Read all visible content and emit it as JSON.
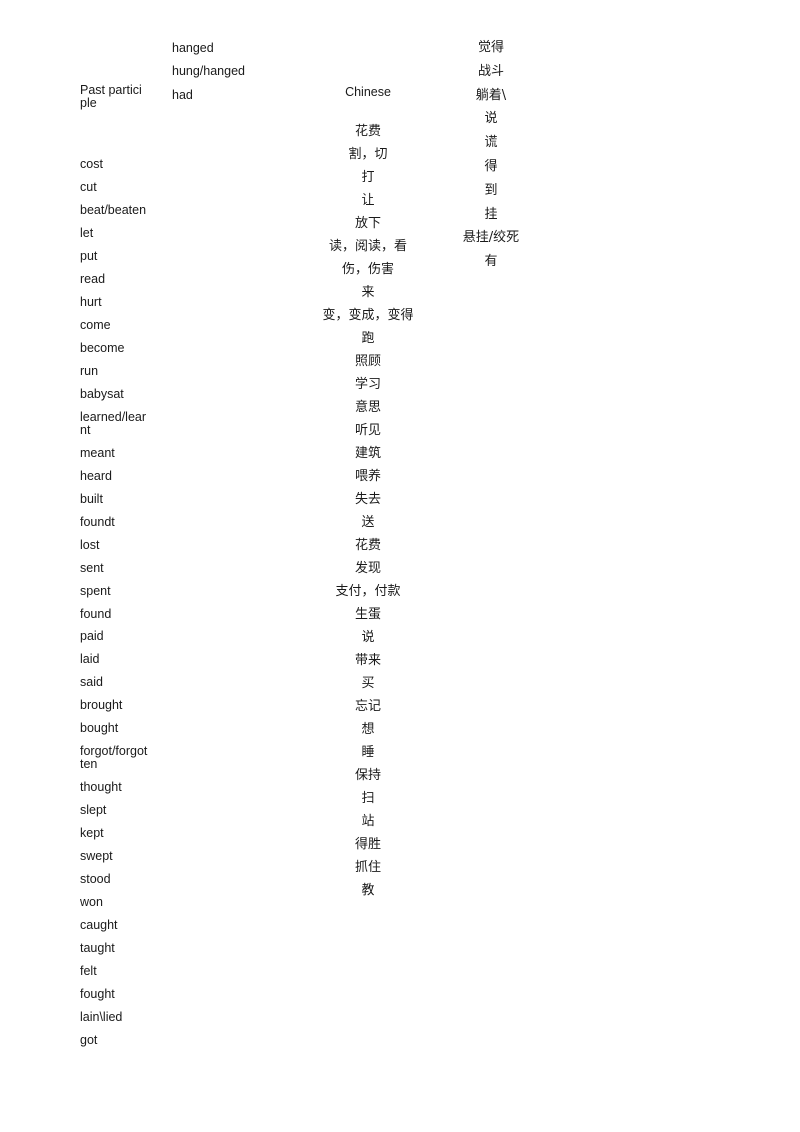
{
  "document": {
    "title": "Irregular Verbs Table (fragment)",
    "background_color": "#ffffff",
    "text_color": "#1a1a1a"
  },
  "past_participle_column": {
    "header": "Past participle",
    "items": [
      "cost",
      "cut",
      "beat/beaten",
      "let",
      "put",
      "read",
      "hurt",
      "come",
      "become",
      "run",
      "babysat",
      "learned/learnt",
      "meant",
      "heard",
      "built",
      "foundt",
      "lost",
      "sent",
      "spent",
      "found",
      "paid",
      "laid",
      "said",
      "brought",
      "bought",
      "forgot/forgotten",
      "thought",
      "slept",
      "kept",
      "swept",
      "stood",
      "won",
      "caught",
      "taught",
      "felt",
      "fought",
      "lain\\lied",
      "got"
    ]
  },
  "overflow_column": {
    "items": [
      "hanged",
      "hung/hanged",
      "had"
    ]
  },
  "chinese_column": {
    "header": "Chinese",
    "items": [
      "花费",
      "割，切",
      "打",
      "让",
      "放下",
      "读，阅读，看",
      "伤，伤害",
      "来",
      "变，变成，变得",
      "跑",
      "照顾",
      "学习",
      "意思",
      "听见",
      "建筑",
      "喂养",
      "失去",
      "送",
      "花费",
      "发现",
      "支付，付款",
      "生蛋",
      "说",
      "带来",
      "买",
      "忘记",
      "想",
      "睡",
      "保持",
      "扫",
      "站",
      "得胜",
      "抓住",
      "教"
    ]
  },
  "chinese_overflow_column": {
    "items": [
      "觉得",
      "战斗",
      "躺着\\",
      "说",
      "谎",
      "得",
      "到",
      "挂",
      "悬挂/绞死",
      "有"
    ]
  }
}
